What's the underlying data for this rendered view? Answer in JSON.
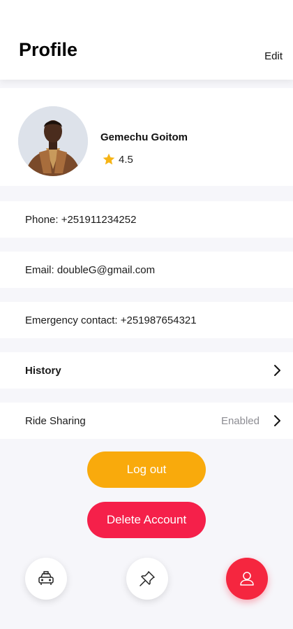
{
  "header": {
    "title": "Profile",
    "edit_label": "Edit"
  },
  "user": {
    "name": "Gemechu Goitom",
    "rating": "4.5"
  },
  "info": {
    "phone": "Phone: +251911234252",
    "email": "Email: doubleG@gmail.com",
    "emergency": "Emergency contact: +251987654321"
  },
  "menu": {
    "history_label": "History",
    "ride_sharing_label": "Ride Sharing",
    "ride_sharing_status": "Enabled"
  },
  "buttons": {
    "logout": "Log out",
    "delete": "Delete Account"
  },
  "nav": {
    "items": [
      {
        "icon": "taxi-icon"
      },
      {
        "icon": "pin-icon"
      },
      {
        "icon": "user-icon",
        "active": true
      }
    ]
  },
  "colors": {
    "accent_yellow": "#f9aa0c",
    "accent_red": "#f5204a",
    "nav_active": "#f5263f",
    "star": "#f6b416"
  }
}
